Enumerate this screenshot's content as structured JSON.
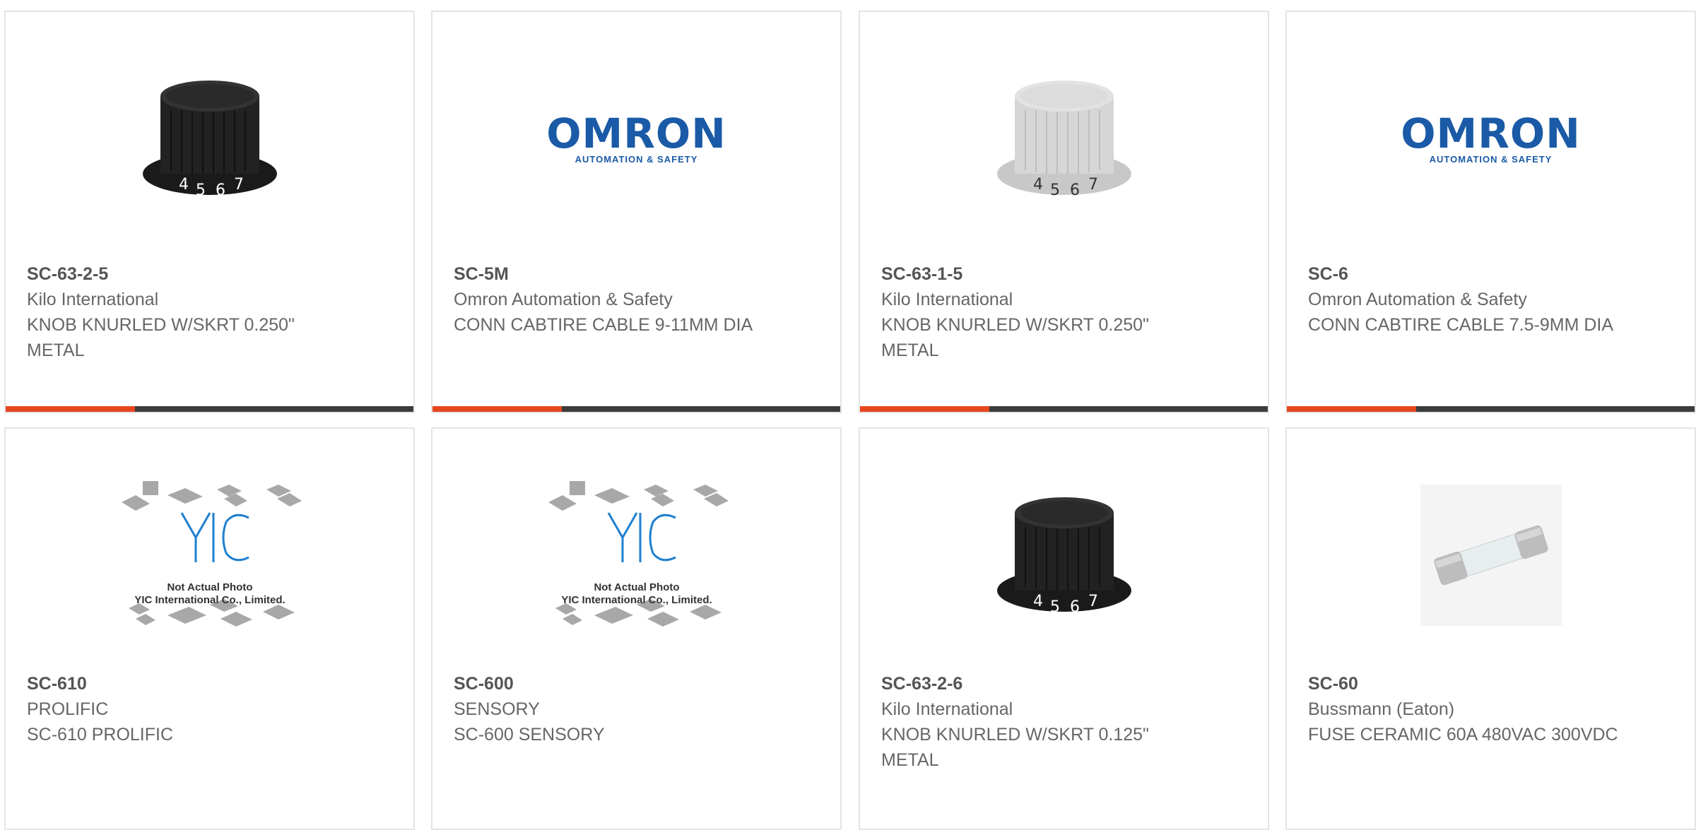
{
  "products": [
    {
      "pn": "SC-63-2-5",
      "mfr": "Kilo International",
      "desc": "KNOB KNURLED W/SKRT 0.250\" METAL",
      "image": "black-knob"
    },
    {
      "pn": "SC-5M",
      "mfr": "Omron Automation & Safety",
      "desc": "CONN CABTIRE CABLE 9-11MM DIA",
      "image": "omron-logo"
    },
    {
      "pn": "SC-63-1-5",
      "mfr": "Kilo International",
      "desc": "KNOB KNURLED W/SKRT 0.250\" METAL",
      "image": "silver-knob"
    },
    {
      "pn": "SC-6",
      "mfr": "Omron Automation & Safety",
      "desc": "CONN CABTIRE CABLE 7.5-9MM DIA",
      "image": "omron-logo"
    },
    {
      "pn": "SC-610",
      "mfr": "PROLIFIC",
      "desc": "SC-610 PROLIFIC",
      "image": "yic-placeholder"
    },
    {
      "pn": "SC-600",
      "mfr": "SENSORY",
      "desc": "SC-600 SENSORY",
      "image": "yic-placeholder"
    },
    {
      "pn": "SC-63-2-6",
      "mfr": "Kilo International",
      "desc": "KNOB KNURLED W/SKRT 0.125\" METAL",
      "image": "black-knob"
    },
    {
      "pn": "SC-60",
      "mfr": "Bussmann (Eaton)",
      "desc": "FUSE CERAMIC 60A 480VAC 300VDC",
      "image": "ceramic-fuse"
    }
  ],
  "omron": {
    "name": "OMRON",
    "tagline": "AUTOMATION & SAFETY"
  },
  "yic": {
    "logo": "YIC",
    "line1": "Not Actual Photo",
    "line2": "YIC International Co., Limited."
  },
  "knob_digits": [
    "4",
    "5",
    "6",
    "7"
  ],
  "colors": {
    "accent": "#e8461f",
    "bar": "#3c3c3c",
    "omron_blue": "#1a5aa6",
    "yic_blue": "#1f7fd0"
  }
}
